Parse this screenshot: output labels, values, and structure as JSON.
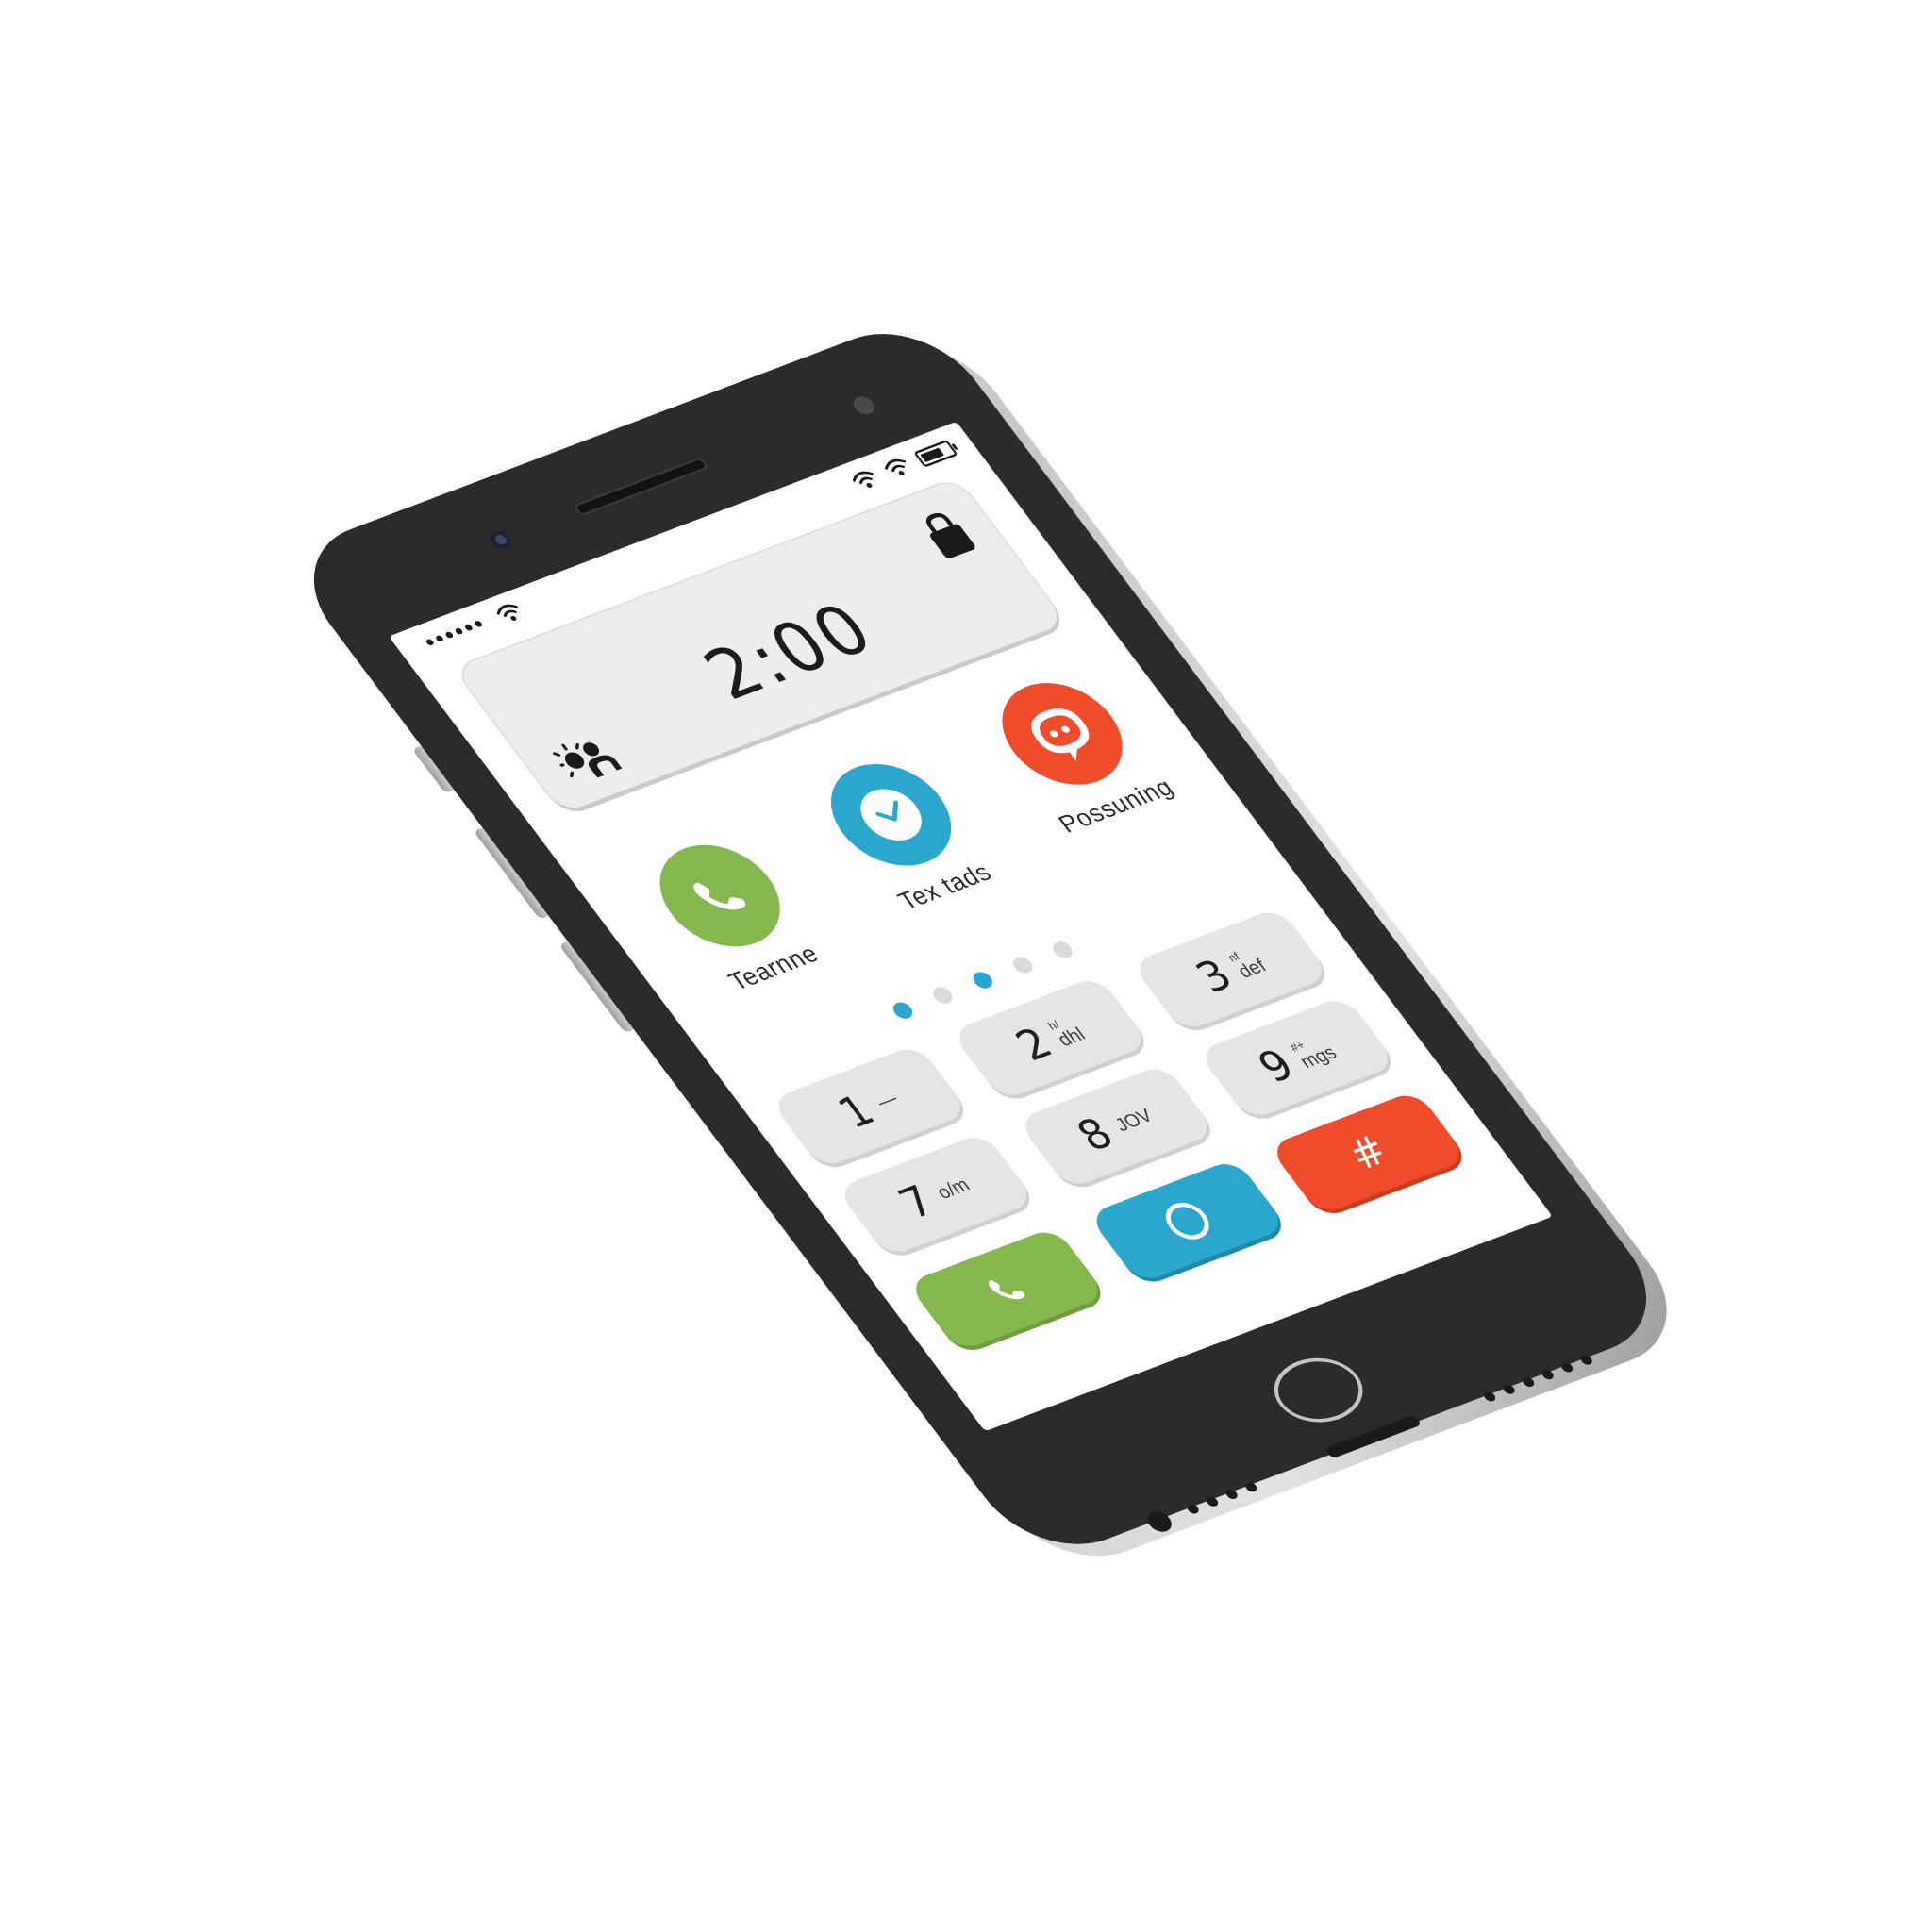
{
  "status_bar": {
    "left_indicators": [
      "signal-dots-icon",
      "wifi-icon"
    ],
    "right_indicators": [
      "wifi-icon",
      "wifi-icon",
      "battery-icon"
    ]
  },
  "widget": {
    "time": "2:00",
    "left_icon": "weather-person-icon",
    "right_icon": "lock-icon"
  },
  "apps": [
    {
      "label": "Tearnne",
      "icon": "phone-icon",
      "color": "#84b84e"
    },
    {
      "label": "Tex tads",
      "icon": "clock-icon",
      "color": "#2ba6cc"
    },
    {
      "label": "Possuning",
      "icon": "chat-bubble-icon",
      "color": "#ee4c2a"
    }
  ],
  "page_indicator": {
    "total": 5,
    "active": [
      0,
      2
    ]
  },
  "keypad": {
    "keys": [
      {
        "digit": "1",
        "letters": "—",
        "sup": ""
      },
      {
        "digit": "2",
        "letters": "dhl",
        "sup": "h/"
      },
      {
        "digit": "3",
        "letters": "def",
        "sup": "nf"
      },
      {
        "digit": "7",
        "letters": "o/m",
        "sup": ""
      },
      {
        "digit": "8",
        "letters": "JOV",
        "sup": ""
      },
      {
        "digit": "9",
        "letters": "mgs",
        "sup": "#+"
      }
    ],
    "hash_label": "#"
  },
  "colors": {
    "accent_green": "#84b84e",
    "accent_blue": "#2ba6cc",
    "accent_red": "#ee4c2a",
    "key_grey": "#e5e5e5",
    "bezel": "#2b2b2b"
  }
}
